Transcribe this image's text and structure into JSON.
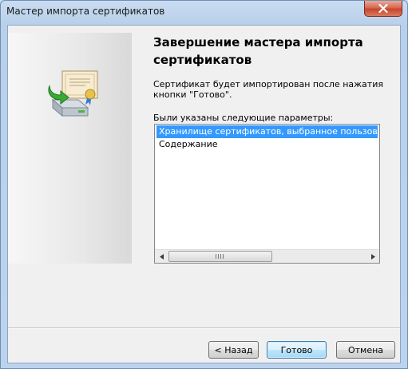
{
  "window": {
    "title": "Мастер импорта сертификатов"
  },
  "page": {
    "heading": "Завершение мастера импорта сертификатов",
    "description": "Сертификат будет импортирован после нажатия кнопки \"Готово\".",
    "params_label": "Были указаны следующие параметры:"
  },
  "params_list": {
    "items": [
      {
        "label": "Хранилище сертификатов, выбранное пользователем",
        "selected": true
      },
      {
        "label": "Содержание",
        "selected": false
      }
    ]
  },
  "buttons": {
    "back": "< Назад",
    "finish": "Готово",
    "cancel": "Отмена"
  },
  "icons": {
    "close": "close-icon",
    "wizard": "certificate-import-wizard-icon",
    "scroll_left": "arrow-left-icon",
    "scroll_right": "arrow-right-icon"
  },
  "colors": {
    "selection": "#3399ff",
    "close_button": "#c7452c"
  }
}
